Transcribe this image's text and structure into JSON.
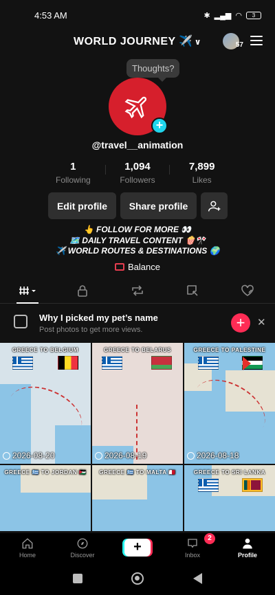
{
  "status_bar": {
    "time": "4:53 AM",
    "battery": "3"
  },
  "header": {
    "title": "WORLD JOURNEY ✈️",
    "visitor_count": "57"
  },
  "profile": {
    "thoughts_placeholder": "Thoughts?",
    "username": "@travel__animation",
    "stats": [
      {
        "value": "1",
        "label": "Following"
      },
      {
        "value": "1,094",
        "label": "Followers"
      },
      {
        "value": "7,899",
        "label": "Likes"
      }
    ],
    "edit_label": "Edit profile",
    "share_label": "Share profile",
    "bio": [
      "👆 FOLLOW FOR MORE 👀",
      "🗺️ DAILY TRAVEL CONTENT 🍿🎌",
      "✈️ WORLD ROUTES & DESTINATIONS 🌍"
    ],
    "balance_label": "Balance"
  },
  "prompt": {
    "title": "Why I picked my pet’s name",
    "subtitle": "Post photos to get more views."
  },
  "videos": [
    {
      "label": "GREECE  TO  BELGIUM",
      "date": "2026-08-20",
      "flags": [
        "gr",
        "be"
      ]
    },
    {
      "label": "GREECE  TO  BELARUS",
      "date": "2026-08-19",
      "flags": [
        "gr",
        "by"
      ]
    },
    {
      "label": "GREECE  TO  PALESTINE",
      "date": "2026-08-18",
      "flags": [
        "gr",
        "ps"
      ]
    },
    {
      "label": "GREECE 🇬🇷 TO JORDAN 🇯🇴",
      "date": "",
      "flags": []
    },
    {
      "label": "GREECE 🇬🇷 TO  MALTA 🇲🇹",
      "date": "",
      "flags": []
    },
    {
      "label": "GREECE  TO  SRI LANKA",
      "date": "",
      "flags": [
        "gr",
        "lk"
      ]
    }
  ],
  "bottom_nav": {
    "home": "Home",
    "discover": "Discover",
    "create": "+",
    "inbox": "Inbox",
    "inbox_badge": "2",
    "profile": "Profile"
  },
  "icons": {
    "avatar_plane": "airplane-icon",
    "add_friend": "add-user-icon",
    "tabs": [
      "grid-icon",
      "lock-icon",
      "repost-icon",
      "tagged-icon",
      "liked-icon"
    ]
  },
  "colors": {
    "accent": "#fe2c55",
    "avatar_bg": "#d61f2c",
    "badge": "#20d5ec"
  }
}
